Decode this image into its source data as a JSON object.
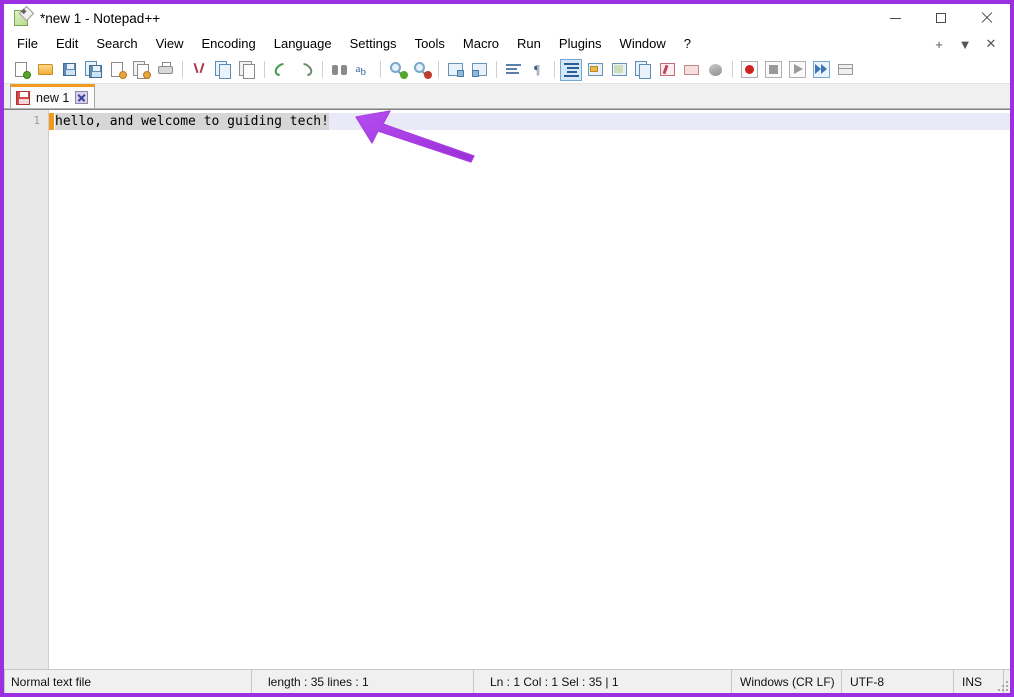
{
  "window": {
    "title": "*new 1 - Notepad++",
    "icon": "notepad-plus-plus-icon",
    "controls": {
      "minimize": "–",
      "maximize": "□",
      "close": "✕"
    }
  },
  "menubar": {
    "items": [
      {
        "label": "File"
      },
      {
        "label": "Edit"
      },
      {
        "label": "Search"
      },
      {
        "label": "View"
      },
      {
        "label": "Encoding"
      },
      {
        "label": "Language"
      },
      {
        "label": "Settings"
      },
      {
        "label": "Tools"
      },
      {
        "label": "Macro"
      },
      {
        "label": "Run"
      },
      {
        "label": "Plugins"
      },
      {
        "label": "Window"
      },
      {
        "label": "?"
      }
    ],
    "right_controls": [
      {
        "name": "add-tab-button",
        "glyph": "+"
      },
      {
        "name": "tab-list-chevron-down-icon",
        "glyph": "▼"
      },
      {
        "name": "close-tab-button",
        "glyph": "✕"
      }
    ]
  },
  "toolbar": {
    "groups": [
      [
        {
          "name": "new-file-icon",
          "tip": "New"
        },
        {
          "name": "open-file-icon",
          "tip": "Open"
        },
        {
          "name": "save-icon",
          "tip": "Save"
        },
        {
          "name": "save-all-icon",
          "tip": "Save All"
        },
        {
          "name": "close-file-icon",
          "tip": "Close"
        },
        {
          "name": "close-all-icon",
          "tip": "Close All"
        },
        {
          "name": "print-icon",
          "tip": "Print"
        }
      ],
      [
        {
          "name": "cut-icon",
          "tip": "Cut"
        },
        {
          "name": "copy-icon",
          "tip": "Copy"
        },
        {
          "name": "paste-icon",
          "tip": "Paste"
        }
      ],
      [
        {
          "name": "undo-icon",
          "tip": "Undo"
        },
        {
          "name": "redo-icon",
          "tip": "Redo"
        }
      ],
      [
        {
          "name": "find-icon",
          "tip": "Find"
        },
        {
          "name": "replace-icon",
          "tip": "Replace"
        }
      ],
      [
        {
          "name": "zoom-in-icon",
          "tip": "Zoom In"
        },
        {
          "name": "zoom-out-icon",
          "tip": "Zoom Out"
        }
      ],
      [
        {
          "name": "sync-vertical-scroll-icon",
          "tip": "Synchronize Vertical Scrolling"
        },
        {
          "name": "sync-horizontal-scroll-icon",
          "tip": "Synchronize Horizontal Scrolling"
        }
      ],
      [
        {
          "name": "word-wrap-icon",
          "tip": "Word wrap"
        },
        {
          "name": "show-all-characters-icon",
          "tip": "Show All Characters"
        }
      ],
      [
        {
          "name": "indent-guideline-icon",
          "tip": "Show Indent Guide",
          "active": true
        },
        {
          "name": "user-defined-dialog-icon",
          "tip": "User-Defined Dialogue"
        },
        {
          "name": "document-map-icon",
          "tip": "Document Map"
        },
        {
          "name": "function-list-icon",
          "tip": "Function List"
        },
        {
          "name": "document-switcher-icon",
          "tip": "Document Switcher"
        },
        {
          "name": "folder-as-workspace-icon",
          "tip": "Folder as Workspace"
        },
        {
          "name": "monitoring-icon",
          "tip": "Monitoring"
        }
      ],
      [
        {
          "name": "record-macro-icon",
          "tip": "Start Recording"
        },
        {
          "name": "stop-macro-icon",
          "tip": "Stop Recording"
        },
        {
          "name": "play-macro-icon",
          "tip": "Playback"
        },
        {
          "name": "run-macro-multiple-icon",
          "tip": "Run a Macro Multiple Times"
        },
        {
          "name": "save-macro-icon",
          "tip": "Save Currently Recorded Macro"
        }
      ]
    ]
  },
  "tabs": [
    {
      "label": "new 1",
      "modified": true,
      "active": true,
      "close_glyph": "✕"
    }
  ],
  "editor": {
    "line_numbers": [
      "1"
    ],
    "lines": [
      "hello, and welcome to guiding tech!"
    ],
    "selection_text": "hello, and welcome to guiding tech!",
    "selected": true,
    "caret_line": 1,
    "caret_column": 1
  },
  "annotation": {
    "type": "arrow",
    "color": "#a93fe0",
    "points_to": "end-of-selected-text"
  },
  "statusbar": {
    "file_type": "Normal text file",
    "length_lines": "length : 35   lines : 1",
    "position": "Ln : 1    Col : 1    Sel : 35 | 1",
    "eol": "Windows (CR LF)",
    "encoding": "UTF-8",
    "insert_mode": "INS"
  },
  "colors": {
    "frame_purple": "#9b30e0",
    "tab_accent_orange": "#f29a1f",
    "current_line": "#e9e9f7",
    "selection": "#d6d6d6",
    "gutter": "#e8e8e8"
  }
}
